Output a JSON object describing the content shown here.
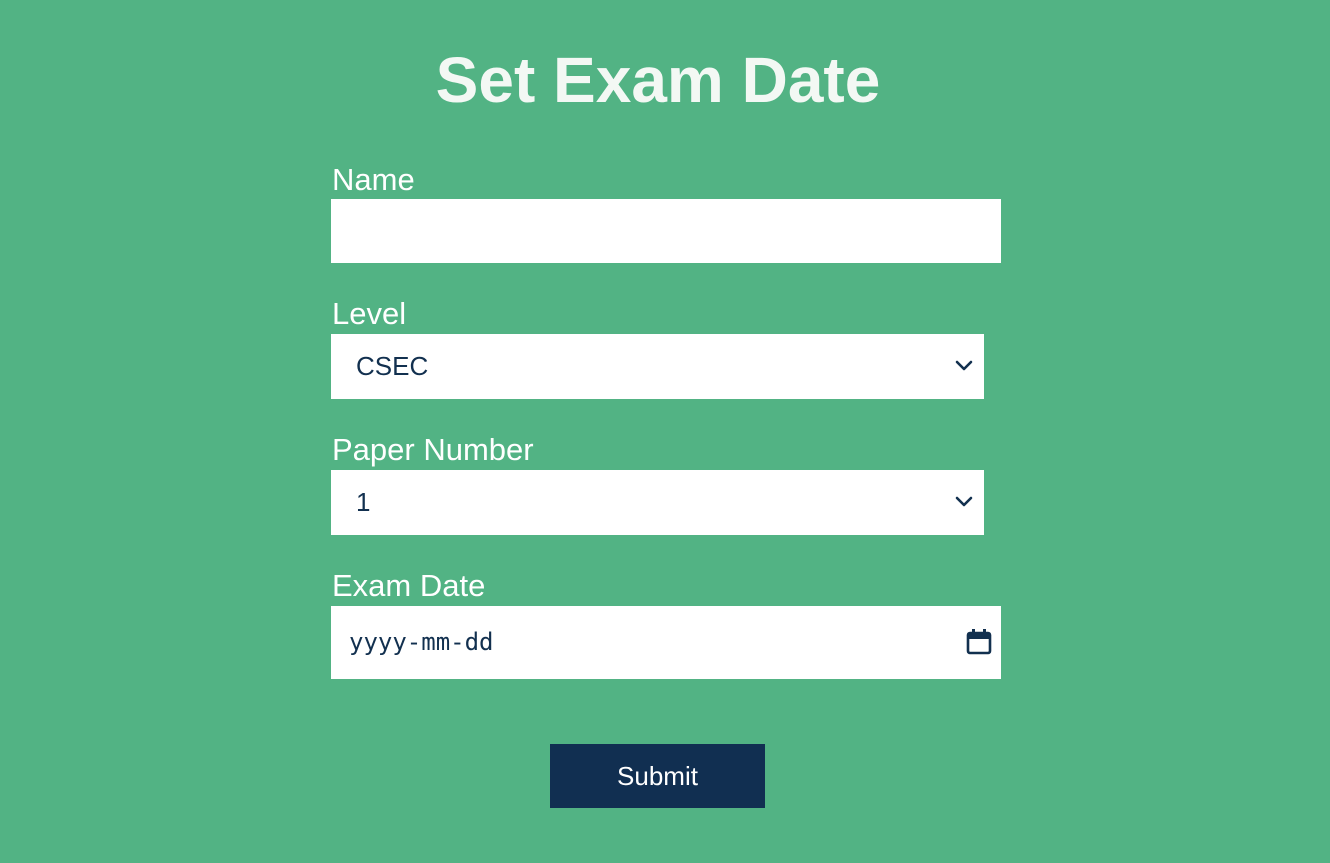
{
  "page": {
    "title": "Set Exam Date"
  },
  "form": {
    "name": {
      "label": "Name",
      "value": "",
      "placeholder": ""
    },
    "level": {
      "label": "Level",
      "selected": "CSEC",
      "icon": "chevron-down-icon"
    },
    "paper_number": {
      "label": "Paper Number",
      "selected": "1",
      "icon": "chevron-down-icon"
    },
    "exam_date": {
      "label": "Exam Date",
      "placeholder": "yyyy-mm-dd",
      "icon": "calendar-icon"
    },
    "submit_label": "Submit"
  },
  "colors": {
    "background": "#52b384",
    "button": "#112f51",
    "field_text": "#12304f",
    "label_text": "#ffffff"
  }
}
